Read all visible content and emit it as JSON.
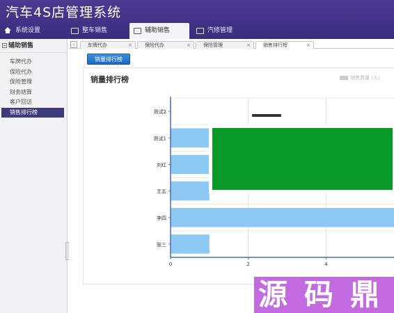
{
  "app": {
    "title": "汽车4S店管理系统"
  },
  "main_tabs": [
    {
      "label": "系统设置",
      "icon": "home-icon",
      "active": false
    },
    {
      "label": "整车销售",
      "icon": "window-icon",
      "active": false
    },
    {
      "label": "辅助销售",
      "icon": "window-icon",
      "active": true
    },
    {
      "label": "汽修管理",
      "icon": "window-icon",
      "active": false
    }
  ],
  "sidebar": {
    "header": "辅助销售",
    "items": [
      {
        "label": "车牌代办",
        "active": false
      },
      {
        "label": "保险代办",
        "active": false
      },
      {
        "label": "保险管理",
        "active": false
      },
      {
        "label": "财务结算",
        "active": false
      },
      {
        "label": "客户回访",
        "active": false
      },
      {
        "label": "销售排行榜",
        "active": true
      }
    ]
  },
  "sub_tabs": [
    {
      "label": "车牌代办",
      "close": "×",
      "active": false
    },
    {
      "label": "保险代办",
      "close": "×",
      "active": false
    },
    {
      "label": "保险管理",
      "close": "×",
      "active": false
    },
    {
      "label": "销售排行榜",
      "close": "×",
      "active": true
    }
  ],
  "sub_tab_nav": "‹",
  "content": {
    "button_label": "销量排行榜"
  },
  "chart_data": {
    "type": "bar",
    "orientation": "horizontal",
    "title": "销量排行榜",
    "legend": {
      "entries": [
        "销售数量 (人)"
      ],
      "position": "top-right"
    },
    "categories": [
      "测试2",
      "测试1",
      "刘红",
      "王五",
      "李四",
      "张三"
    ],
    "values": [
      0,
      1,
      1,
      1,
      10,
      1
    ],
    "series": [
      {
        "name": "销售数量 (人)",
        "values": [
          0,
          1,
          1,
          1,
          10,
          1
        ],
        "color": "#8ec9f5"
      }
    ],
    "xticks": [
      "0",
      "2",
      "4"
    ],
    "xlim": [
      0,
      6
    ],
    "grid": true
  },
  "watermark": {
    "text": "源码鼎",
    "color": "#c46ae0"
  },
  "colors": {
    "header": "#43348a",
    "accent": "#1d66c4",
    "bar": "#8ec9f5",
    "sidebar_active": "#3d3a7e",
    "overlay": "#0a9a2a"
  }
}
